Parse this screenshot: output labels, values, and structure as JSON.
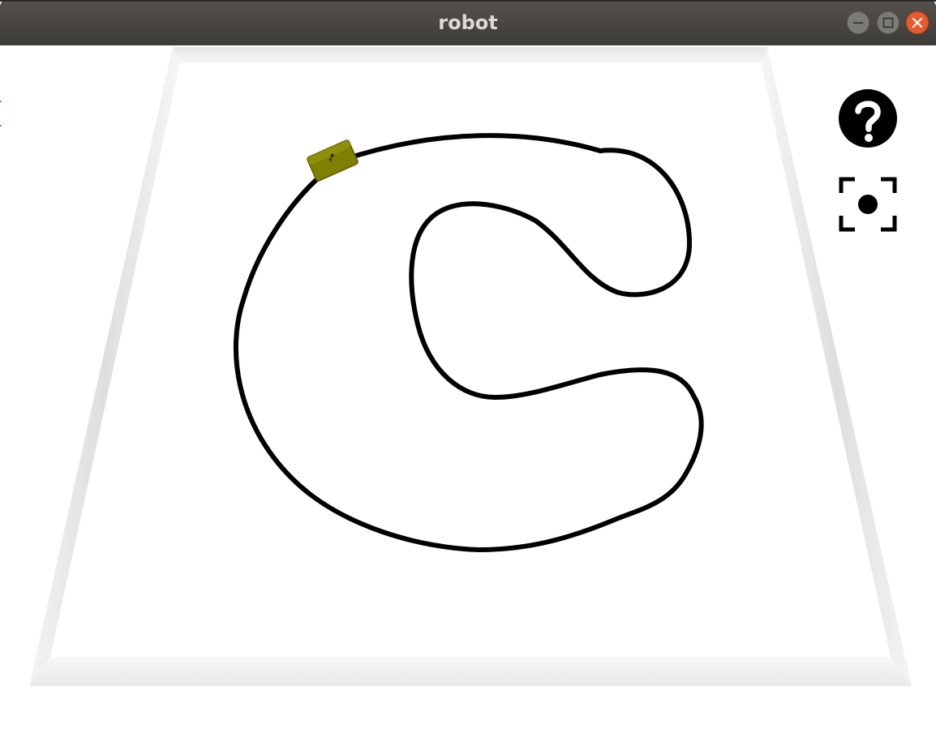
{
  "window": {
    "title": "robot"
  },
  "titlebar": {
    "buttons": [
      {
        "name": "minimize",
        "icon": "minimize-icon"
      },
      {
        "name": "maximize",
        "icon": "maximize-icon"
      },
      {
        "name": "close",
        "icon": "close-icon"
      }
    ]
  },
  "viewport": {
    "overlay_buttons": [
      {
        "name": "help",
        "icon": "question-mark-icon"
      },
      {
        "name": "focus",
        "icon": "focus-target-icon"
      }
    ],
    "scene": {
      "floor_color": "#ffffff",
      "track_color": "#000000",
      "robot_color": "#808000",
      "track_shape": "C-shaped closed loop line"
    }
  }
}
